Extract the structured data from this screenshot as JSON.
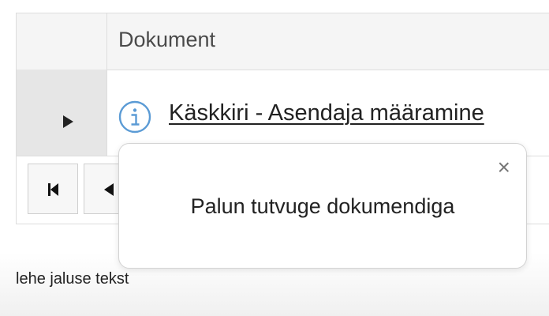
{
  "grid": {
    "column_header": "Dokument",
    "rows": [
      {
        "document_title": "Käskkiri - Asendaja määramine",
        "icon": "info-icon"
      }
    ]
  },
  "pager": {
    "first_icon": "first-page-icon",
    "prev_icon": "previous-page-icon"
  },
  "popover": {
    "message": "Palun tutvuge dokumendiga",
    "close_label": "×"
  },
  "footer": {
    "text": "lehe jaluse tekst"
  },
  "colors": {
    "info_icon": "#5b9bd5",
    "header_bg": "#f5f5f5",
    "row_selector_bg": "#e6e6e6",
    "border": "#dddddd"
  }
}
